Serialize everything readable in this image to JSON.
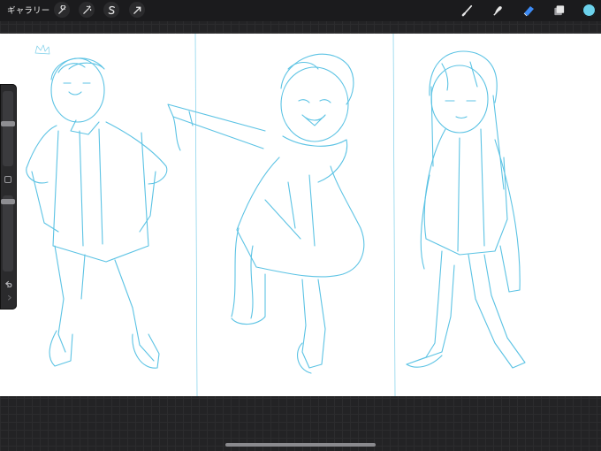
{
  "app": {
    "gallery_label": "ギャラリー"
  },
  "toolbar": {
    "left_buttons": [
      "wrench-icon",
      "magic-wand-icon",
      "selection-s-icon",
      "transform-arrow-icon"
    ],
    "right_tools": [
      "brush-icon",
      "smudge-icon",
      "eraser-icon",
      "layers-icon"
    ],
    "active_tool": "eraser-icon",
    "current_color": "#6cd2ec"
  },
  "sidebar": {
    "brush_size_level": 0.33,
    "opacity_level": 0.0,
    "modify_button": "square-icon",
    "undo": "undo-icon",
    "redo": "redo-icon"
  },
  "canvas": {
    "background": "#ffffff",
    "sketch_color": "#5cc3e4",
    "panels": 3
  }
}
